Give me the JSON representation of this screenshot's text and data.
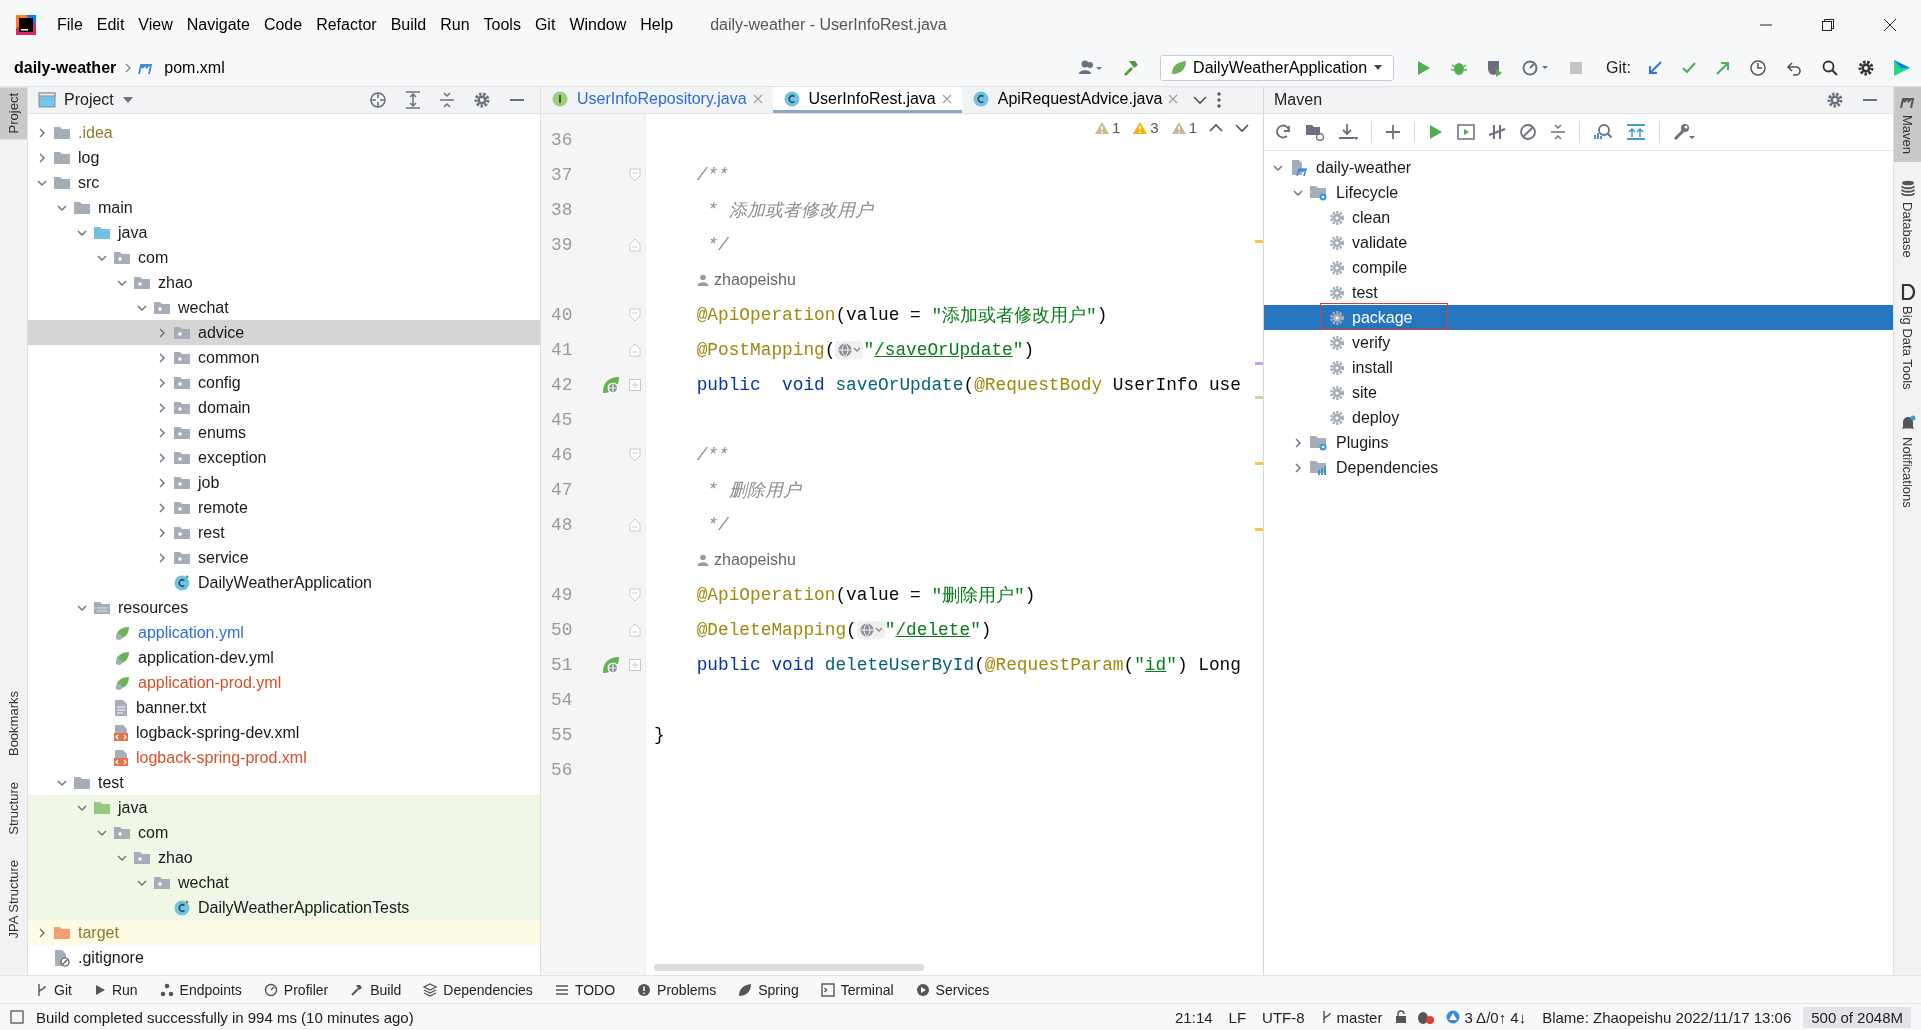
{
  "title_bar": {
    "menu": [
      "File",
      "Edit",
      "View",
      "Navigate",
      "Code",
      "Refactor",
      "Build",
      "Run",
      "Tools",
      "Git",
      "Window",
      "Help"
    ],
    "title": "daily-weather - UserInfoRest.java"
  },
  "nav_bar": {
    "breadcrumbs": [
      {
        "label": "daily-weather",
        "kind": "project"
      },
      {
        "label": "pom.xml",
        "kind": "maven-file"
      }
    ],
    "run_config": "DailyWeatherApplication",
    "git_label": "Git:"
  },
  "left_strip": {
    "top": [
      {
        "label": "Project",
        "selected": true
      }
    ],
    "bottom": [
      {
        "label": "Bookmarks",
        "selected": false
      },
      {
        "label": "Structure",
        "selected": false
      },
      {
        "label": "JPA Structure",
        "selected": false
      }
    ]
  },
  "project_panel": {
    "title": "Project",
    "tree": [
      {
        "label": ".idea",
        "kind": "folder",
        "color": "#8c7a2e",
        "expanded": false,
        "selected": false
      },
      {
        "label": "log",
        "kind": "folder",
        "expanded": false,
        "selected": false
      },
      {
        "label": "src",
        "kind": "folder",
        "expanded": true,
        "selected": false,
        "children": [
          {
            "label": "main",
            "kind": "folder",
            "expanded": true,
            "selected": false,
            "children": [
              {
                "label": "java",
                "kind": "source-root",
                "expanded": true,
                "selected": false,
                "children": [
                  {
                    "label": "com",
                    "kind": "package",
                    "expanded": true,
                    "selected": false,
                    "children": [
                      {
                        "label": "zhao",
                        "kind": "package",
                        "expanded": true,
                        "selected": false,
                        "children": [
                          {
                            "label": "wechat",
                            "kind": "package",
                            "expanded": true,
                            "selected": false,
                            "children": [
                              {
                                "label": "advice",
                                "kind": "package",
                                "expanded": false,
                                "selected": true
                              },
                              {
                                "label": "common",
                                "kind": "package",
                                "expanded": false,
                                "selected": false
                              },
                              {
                                "label": "config",
                                "kind": "package",
                                "expanded": false,
                                "selected": false
                              },
                              {
                                "label": "domain",
                                "kind": "package",
                                "expanded": false,
                                "selected": false
                              },
                              {
                                "label": "enums",
                                "kind": "package",
                                "expanded": false,
                                "selected": false
                              },
                              {
                                "label": "exception",
                                "kind": "package",
                                "expanded": false,
                                "selected": false
                              },
                              {
                                "label": "job",
                                "kind": "package",
                                "expanded": false,
                                "selected": false
                              },
                              {
                                "label": "remote",
                                "kind": "package",
                                "expanded": false,
                                "selected": false
                              },
                              {
                                "label": "rest",
                                "kind": "package",
                                "expanded": false,
                                "selected": false
                              },
                              {
                                "label": "service",
                                "kind": "package",
                                "expanded": false,
                                "selected": false
                              },
                              {
                                "label": "DailyWeatherApplication",
                                "kind": "spring-class",
                                "selected": false
                              }
                            ]
                          }
                        ]
                      }
                    ]
                  }
                ]
              },
              {
                "label": "resources",
                "kind": "resources",
                "expanded": true,
                "selected": false,
                "children": [
                  {
                    "label": "application.yml",
                    "kind": "yml-file",
                    "color": "#2e6bd8",
                    "selected": false
                  },
                  {
                    "label": "application-dev.yml",
                    "kind": "yml-file",
                    "selected": false
                  },
                  {
                    "label": "application-prod.yml",
                    "kind": "yml-file",
                    "color": "#d0502a",
                    "selected": false
                  },
                  {
                    "label": "banner.txt",
                    "kind": "text-file",
                    "selected": false
                  },
                  {
                    "label": "logback-spring-dev.xml",
                    "kind": "xml-file",
                    "selected": false
                  },
                  {
                    "label": "logback-spring-prod.xml",
                    "kind": "xml-file",
                    "color": "#d0502a",
                    "selected": false
                  }
                ]
              }
            ]
          },
          {
            "label": "test",
            "kind": "folder",
            "expanded": true,
            "selected": false,
            "children": [
              {
                "label": "java",
                "kind": "test-root",
                "test_source": true,
                "expanded": true,
                "selected": false,
                "children": [
                  {
                    "label": "com",
                    "kind": "package",
                    "test_source": true,
                    "expanded": true,
                    "selected": false,
                    "children": [
                      {
                        "label": "zhao",
                        "kind": "package",
                        "test_source": true,
                        "expanded": true,
                        "selected": false,
                        "children": [
                          {
                            "label": "wechat",
                            "kind": "package",
                            "test_source": true,
                            "expanded": true,
                            "selected": false,
                            "children": [
                              {
                                "label": "DailyWeatherApplicationTests",
                                "kind": "test-class",
                                "test_source": true,
                                "selected": false
                              }
                            ]
                          }
                        ]
                      }
                    ]
                  }
                ]
              }
            ]
          }
        ]
      },
      {
        "label": "target",
        "kind": "excluded",
        "excluded": true,
        "color": "#8c7a2e",
        "expanded": false,
        "selected": false
      },
      {
        "label": ".gitignore",
        "kind": "ignore-file",
        "selected": false
      }
    ]
  },
  "editor": {
    "tabs": [
      {
        "label": "UserInfoRepository.java",
        "kind": "interface",
        "color": "#2e6bd8",
        "selected": false
      },
      {
        "label": "UserInfoRest.java",
        "kind": "class",
        "selected": true
      },
      {
        "label": "ApiRequestAdvice.java",
        "kind": "class",
        "selected": false
      }
    ],
    "inspections": [
      {
        "color": "#c9b98d",
        "count": "1"
      },
      {
        "color": "#f2b600",
        "count": "3"
      },
      {
        "color": "#c9b98d",
        "count": "1"
      }
    ],
    "lines": [
      {
        "kind": "code",
        "number": "36"
      },
      {
        "kind": "code",
        "number": "37",
        "fold_start": true,
        "tokens": [
          {
            "kind": "comment",
            "text": "    /**"
          }
        ]
      },
      {
        "kind": "code",
        "number": "38",
        "tokens": [
          {
            "kind": "comment",
            "text": "     * "
          },
          {
            "kind": "comment-cjk",
            "text": "添加或者修改用户"
          }
        ]
      },
      {
        "kind": "code",
        "number": "39",
        "fold_end": true,
        "tokens": [
          {
            "kind": "comment",
            "text": "     */"
          }
        ]
      },
      {
        "kind": "author",
        "author": "zhaopeishu"
      },
      {
        "kind": "code",
        "number": "40",
        "fold_start": true,
        "tokens": [
          {
            "kind": "annotation",
            "text": "    @ApiOperation"
          },
          {
            "kind": "plain",
            "text": "(value = "
          },
          {
            "kind": "string",
            "text": "\"添加或者修改用户\""
          },
          {
            "kind": "plain",
            "text": ")"
          }
        ]
      },
      {
        "kind": "code",
        "number": "41",
        "fold_end": true,
        "tokens": [
          {
            "kind": "annotation",
            "text": "    @PostMapping"
          },
          {
            "kind": "plain",
            "text": "("
          },
          {
            "kind": "inlay"
          },
          {
            "kind": "string",
            "text": "\""
          },
          {
            "kind": "url",
            "text": "/saveOrUpdate"
          },
          {
            "kind": "string",
            "text": "\""
          },
          {
            "kind": "plain",
            "text": ")"
          }
        ]
      },
      {
        "kind": "code",
        "number": "42",
        "folded": true,
        "endpoint": true,
        "tokens": [
          {
            "kind": "keyword",
            "text": "    public  void "
          },
          {
            "kind": "method",
            "text": "saveOrUpdate"
          },
          {
            "kind": "plain",
            "text": "("
          },
          {
            "kind": "annotation",
            "text": "@RequestBody"
          },
          {
            "kind": "plain",
            "text": " UserInfo use"
          }
        ]
      },
      {
        "kind": "code",
        "number": "45"
      },
      {
        "kind": "code",
        "number": "46",
        "fold_start": true,
        "tokens": [
          {
            "kind": "comment",
            "text": "    /**"
          }
        ]
      },
      {
        "kind": "code",
        "number": "47",
        "tokens": [
          {
            "kind": "comment",
            "text": "     * "
          },
          {
            "kind": "comment-cjk",
            "text": "删除用户"
          }
        ]
      },
      {
        "kind": "code",
        "number": "48",
        "fold_end": true,
        "tokens": [
          {
            "kind": "comment",
            "text": "     */"
          }
        ]
      },
      {
        "kind": "author",
        "author": "zhaopeishu"
      },
      {
        "kind": "code",
        "number": "49",
        "fold_start": true,
        "tokens": [
          {
            "kind": "annotation",
            "text": "    @ApiOperation"
          },
          {
            "kind": "plain",
            "text": "(value = "
          },
          {
            "kind": "string",
            "text": "\"删除用户\""
          },
          {
            "kind": "plain",
            "text": ")"
          }
        ]
      },
      {
        "kind": "code",
        "number": "50",
        "fold_end": true,
        "tokens": [
          {
            "kind": "annotation",
            "text": "    @DeleteMapping"
          },
          {
            "kind": "plain",
            "text": "("
          },
          {
            "kind": "inlay"
          },
          {
            "kind": "string",
            "text": "\""
          },
          {
            "kind": "url",
            "text": "/delete"
          },
          {
            "kind": "string",
            "text": "\""
          },
          {
            "kind": "plain",
            "text": ")"
          }
        ]
      },
      {
        "kind": "code",
        "number": "51",
        "folded": true,
        "endpoint": true,
        "tokens": [
          {
            "kind": "keyword",
            "text": "    public void "
          },
          {
            "kind": "method",
            "text": "deleteUserById"
          },
          {
            "kind": "plain",
            "text": "("
          },
          {
            "kind": "annotation",
            "text": "@RequestParam"
          },
          {
            "kind": "plain",
            "text": "("
          },
          {
            "kind": "string",
            "text": "\""
          },
          {
            "kind": "url",
            "text": "id"
          },
          {
            "kind": "string",
            "text": "\""
          },
          {
            "kind": "plain",
            "text": ") Long"
          }
        ]
      },
      {
        "kind": "code",
        "number": "54"
      },
      {
        "kind": "code",
        "number": "55",
        "tokens": [
          {
            "kind": "plain",
            "text": "}"
          }
        ]
      },
      {
        "kind": "code",
        "number": "56"
      }
    ]
  },
  "maven_panel": {
    "title": "Maven",
    "tree": [
      {
        "label": "daily-weather",
        "kind": "project",
        "expanded": true,
        "selected": false,
        "children": [
          {
            "label": "Lifecycle",
            "kind": "lifecycle",
            "expanded": true,
            "selected": false,
            "children": [
              {
                "label": "clean",
                "kind": "goal",
                "selected": false
              },
              {
                "label": "validate",
                "kind": "goal",
                "selected": false
              },
              {
                "label": "compile",
                "kind": "goal",
                "selected": false
              },
              {
                "label": "test",
                "kind": "goal",
                "selected": false
              },
              {
                "label": "package",
                "kind": "goal",
                "selected": true
              },
              {
                "label": "verify",
                "kind": "goal",
                "selected": false
              },
              {
                "label": "install",
                "kind": "goal",
                "selected": false
              },
              {
                "label": "site",
                "kind": "goal",
                "selected": false
              },
              {
                "label": "deploy",
                "kind": "goal",
                "selected": false
              }
            ]
          },
          {
            "label": "Plugins",
            "kind": "lifecycle",
            "expanded": false,
            "selected": false
          },
          {
            "label": "Dependencies",
            "kind": "dependencies",
            "expanded": false,
            "selected": false
          }
        ]
      }
    ]
  },
  "right_strip": [
    {
      "label": "Maven",
      "kind": "maven",
      "selected": true
    },
    {
      "label": "Database",
      "kind": "database",
      "selected": false
    },
    {
      "label": "Big Data Tools",
      "kind": "bigdata",
      "selected": false
    },
    {
      "label": "Notifications",
      "kind": "bell",
      "selected": false
    }
  ],
  "tool_tabs": [
    {
      "label": "Git",
      "kind": "git"
    },
    {
      "label": "Run",
      "kind": "run"
    },
    {
      "label": "Endpoints",
      "kind": "endpoints"
    },
    {
      "label": "Profiler",
      "kind": "profiler"
    },
    {
      "label": "Build",
      "kind": "build"
    },
    {
      "label": "Dependencies",
      "kind": "dependencies"
    },
    {
      "label": "TODO",
      "kind": "todo"
    },
    {
      "label": "Problems",
      "kind": "problems"
    },
    {
      "label": "Spring",
      "kind": "spring"
    },
    {
      "label": "Terminal",
      "kind": "terminal"
    },
    {
      "label": "Services",
      "kind": "services"
    }
  ],
  "status_bar": {
    "message": "Build completed successfully in 994 ms (10 minutes ago)",
    "position": "21:14",
    "line_separator": "LF",
    "encoding": "UTF-8",
    "branch": "master",
    "changes": "3 Δ/0↑ 4↓",
    "blame": "Blame: Zhaopeishu 2022/11/17 13:06",
    "memory": "500 of 2048M"
  }
}
